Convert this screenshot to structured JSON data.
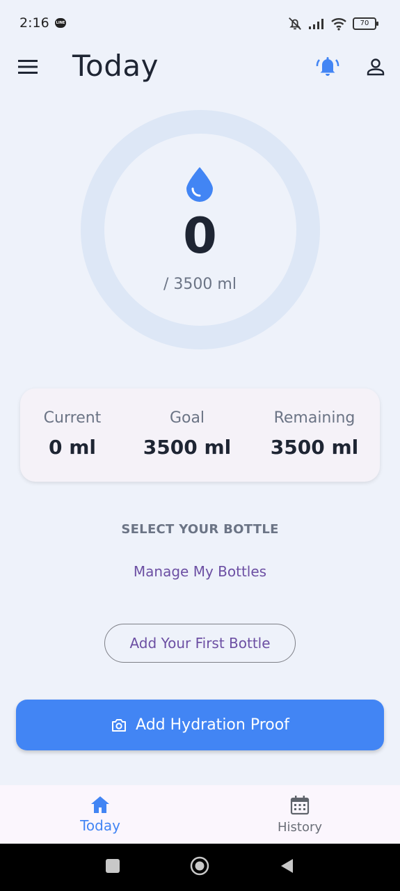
{
  "status_bar": {
    "time": "2:16",
    "notification_app": "LINE",
    "battery": "70"
  },
  "header": {
    "title": "Today"
  },
  "progress": {
    "current_amount": "0",
    "goal_text": "/ 3500 ml",
    "fraction": 0
  },
  "stats": [
    {
      "label": "Current",
      "value": "0 ml"
    },
    {
      "label": "Goal",
      "value": "3500 ml"
    },
    {
      "label": "Remaining",
      "value": "3500 ml"
    }
  ],
  "bottles": {
    "heading": "SELECT YOUR BOTTLE",
    "manage_link": "Manage My Bottles",
    "add_first_label": "Add Your First Bottle"
  },
  "primary_action": {
    "label": "Add Hydration Proof"
  },
  "bottom_nav": [
    {
      "label": "Today",
      "icon": "home-icon",
      "active": true
    },
    {
      "label": "History",
      "icon": "calendar-icon",
      "active": false
    }
  ],
  "colors": {
    "accent": "#4285f4",
    "link": "#6c4fa3",
    "ring_track": "#dde7f6",
    "background": "#eef2fa"
  }
}
